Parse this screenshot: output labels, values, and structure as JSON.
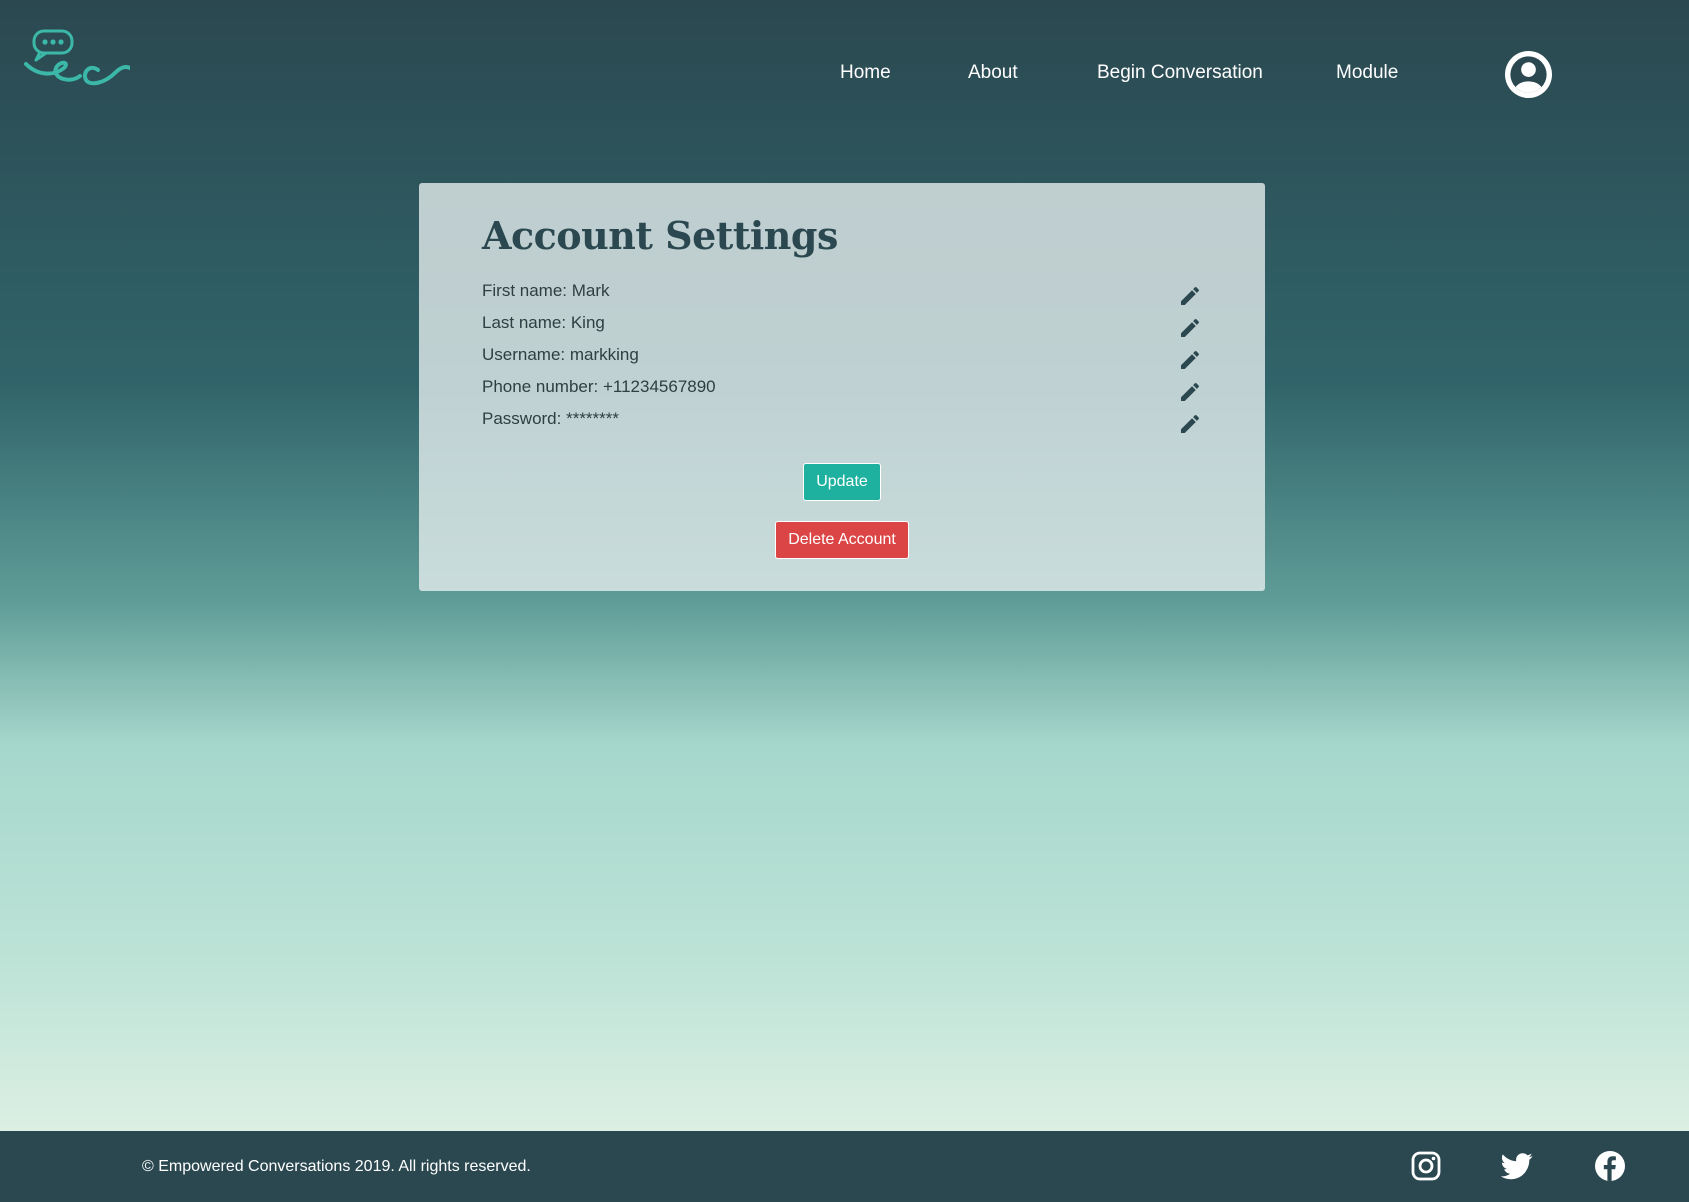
{
  "nav": {
    "items": [
      {
        "label": "Home"
      },
      {
        "label": "About"
      },
      {
        "label": "Begin Conversation"
      },
      {
        "label": "Module"
      }
    ]
  },
  "account": {
    "title": "Account Settings",
    "fields": [
      {
        "text": "First name: Mark"
      },
      {
        "text": "Last name: King"
      },
      {
        "text": "Username: markking"
      },
      {
        "text": "Phone number: +11234567890"
      },
      {
        "text": "Password: ********"
      }
    ],
    "update_label": "Update",
    "delete_label": "Delete Account"
  },
  "footer": {
    "copyright": "© Empowered Conversations 2019. All rights reserved."
  },
  "icons": {
    "logo": "chat-bubble-logo",
    "profile": "user-avatar-icon",
    "edit": "pencil-icon",
    "social": [
      "instagram-icon",
      "twitter-icon",
      "facebook-icon"
    ]
  },
  "colors": {
    "brand_dark": "#2b4850",
    "accent_teal": "#1eb1a0",
    "danger_red": "#dc4545",
    "logo_teal": "#3cb8a9"
  }
}
